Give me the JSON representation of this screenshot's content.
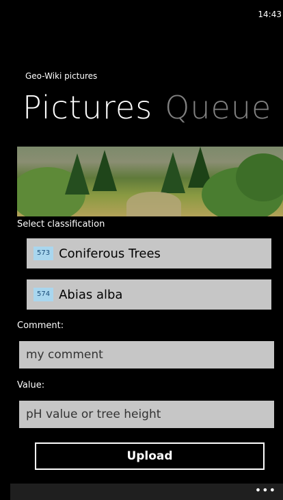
{
  "status": {
    "time": "14:43"
  },
  "app": {
    "title": "Geo-Wiki pictures"
  },
  "pivot": {
    "items": [
      {
        "label": "Pictures"
      },
      {
        "label": "Queue"
      }
    ]
  },
  "classification": {
    "label": "Select classification",
    "items": [
      {
        "code": "573",
        "name": "Coniferous Trees"
      },
      {
        "code": "574",
        "name": "Abias alba"
      }
    ]
  },
  "comment": {
    "label": "Comment:",
    "value": "my comment"
  },
  "value": {
    "label": "Value:",
    "placeholder": "pH value or tree height"
  },
  "upload": {
    "label": "Upload"
  },
  "appbar": {
    "more_label": "•••"
  },
  "colors": {
    "field_bg": "#c6c6c6",
    "code_bg": "#a9d6ee",
    "background": "#000000",
    "inactive_pivot": "#808080"
  }
}
